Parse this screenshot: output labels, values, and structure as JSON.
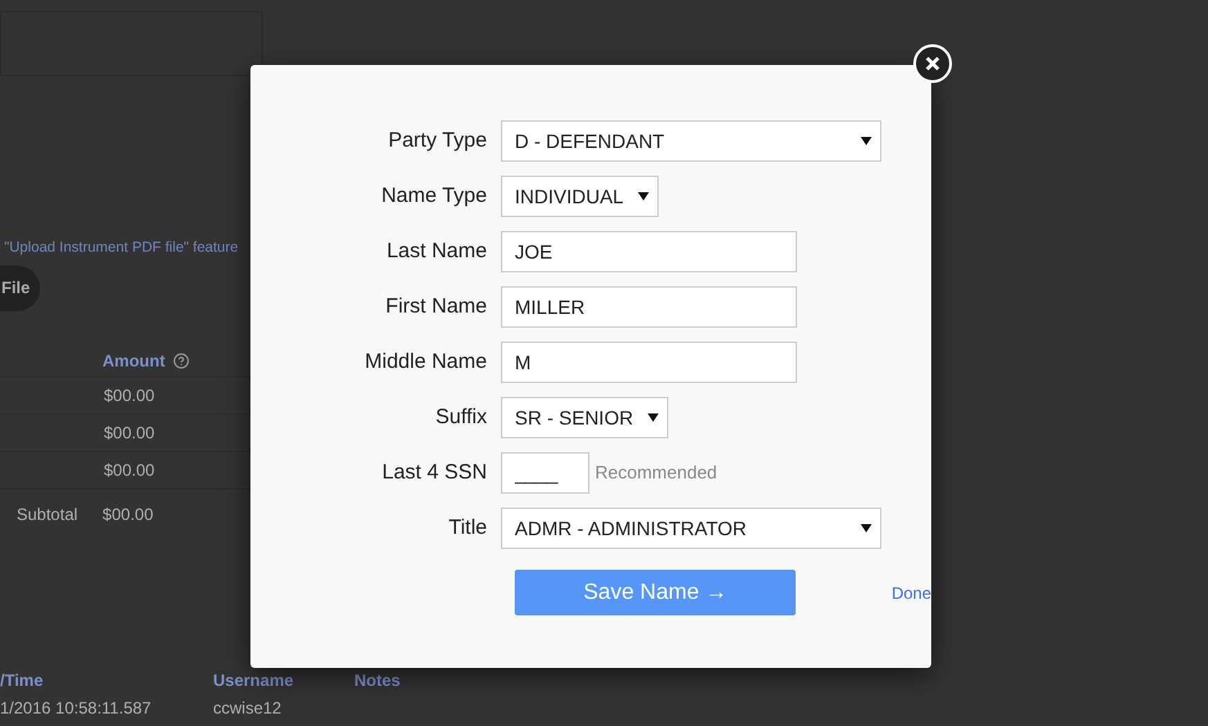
{
  "background": {
    "upload_link": "\"Upload Instrument PDF file\" feature",
    "file_button": "File",
    "fees_table": {
      "columns": [
        "Amount"
      ],
      "rows": [
        "$00.00",
        "$00.00",
        "$00.00"
      ],
      "subtotal_label": "Subtotal",
      "subtotal": "$00.00"
    },
    "history_table": {
      "columns": [
        "/Time",
        "Username",
        "Notes"
      ],
      "rows": [
        [
          "1/2016 10:58:11.587",
          "ccwise12"
        ]
      ]
    }
  },
  "dialog": {
    "fields": [
      {
        "label": "Party Type",
        "kind": "wide_select",
        "value": "D - DEFENDANT"
      },
      {
        "label": "Name Type",
        "kind": "select",
        "value": "INDIVIDUAL"
      },
      {
        "label": "Last Name",
        "kind": "text",
        "value": "JOE"
      },
      {
        "label": "First Name",
        "kind": "text",
        "value": "MILLER"
      },
      {
        "label": "Middle Name",
        "kind": "text",
        "value": "M"
      },
      {
        "label": "Suffix",
        "kind": "select",
        "value": "SR - SENIOR"
      },
      {
        "label": "Last 4 SSN",
        "kind": "short",
        "value": "____",
        "note": "Recommended"
      },
      {
        "label": "Title",
        "kind": "wide_select",
        "value": "ADMR - ADMINISTRATOR"
      }
    ],
    "save_button": "Save Name →",
    "done_link": "Done"
  }
}
